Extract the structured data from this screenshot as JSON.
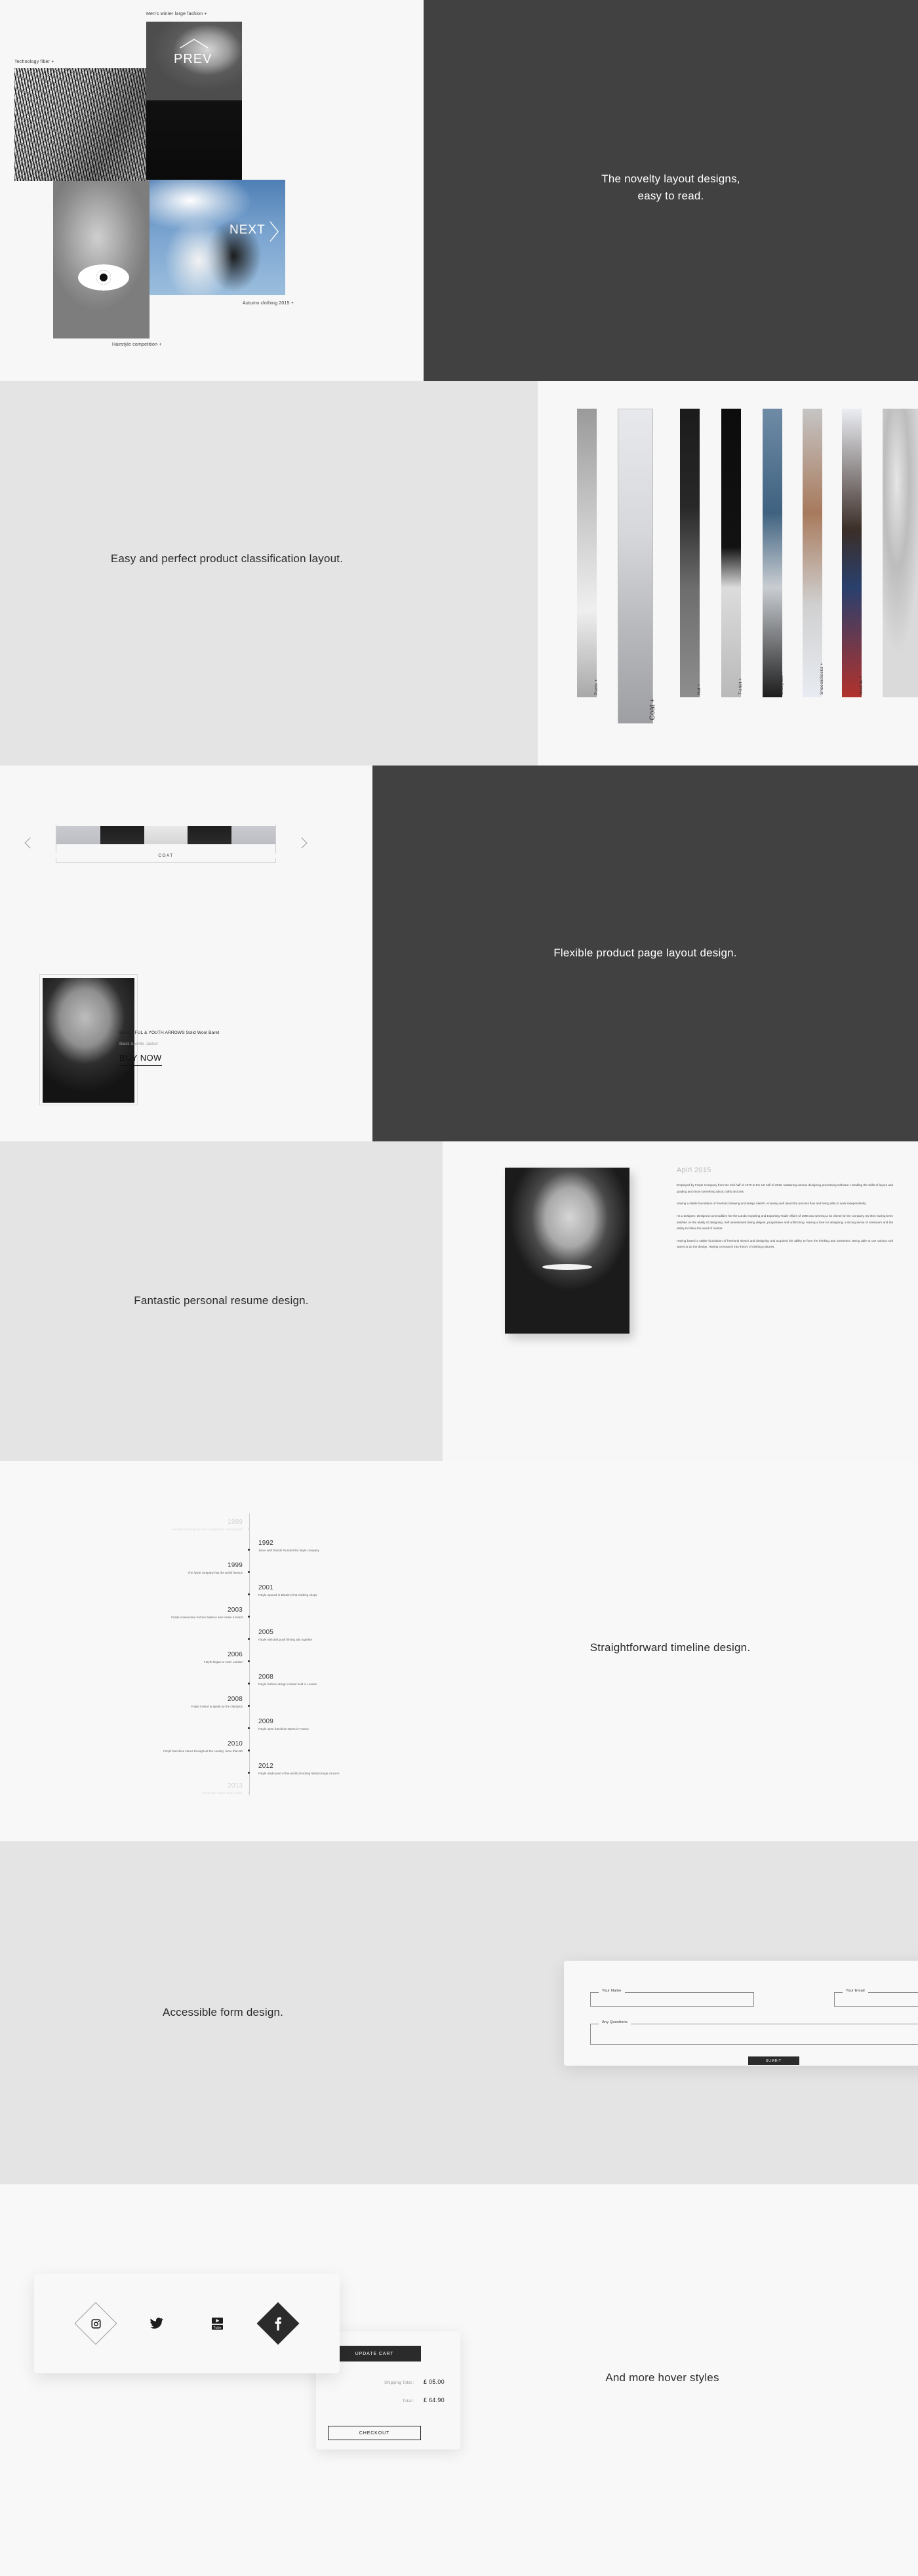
{
  "sections": {
    "hero": {
      "tagline_line1": "The novelty layout designs,",
      "tagline_line2": "easy to read.",
      "captions": {
        "fiber": "Technology fiber +",
        "winter": "Men's winter large fashion +",
        "hairstyle": "Hairstyle competition +",
        "autumn": "Autumn clothing 2015 +"
      },
      "nav": {
        "prev": "PREV",
        "next": "NEXT"
      }
    },
    "classification": {
      "tagline": "Easy and perfect product classification layout.",
      "categories": [
        {
          "label": "Pants +",
          "featured": false
        },
        {
          "label": "Coat +",
          "featured": true
        },
        {
          "label": "Hat +",
          "featured": false
        },
        {
          "label": "T-shirt +",
          "featured": false
        },
        {
          "label": "Backpack +",
          "featured": false
        },
        {
          "label": "Shoes&Socks +",
          "featured": false
        },
        {
          "label": "Necktie +",
          "featured": false
        }
      ]
    },
    "product": {
      "tagline": "Flexible product page layout design.",
      "slider_label": "COAT",
      "title": "BEAYTIFUL & YOUTH ARROWS Solid Wool Baret",
      "subtitle": "Black & white Jacket",
      "buy_label": "BUY NOW"
    },
    "resume": {
      "tagline": "Fantastic personal resume design.",
      "date": "Apirl 2015",
      "paragraphs": [
        "Employed by Futyle Company from the 2nd half of 1976 to the 1st half of 2016. Mastering various designing processing software. Handling the skills of layout and grading and know something about crafts and arts.",
        "Having a stable foundation of freehand drawing and design sketch. Knowing well about the process flow and being able to work independently.",
        "As a designer. Designed commodities foe the Londo Importing and Exporting Trade Affairs of 1998 and winning a lot clients for the company. By then having been testified on the ability of designing. Self assessment Being diligent, progressive and unflinching. Having a love for designing, a strong sense of teamwork and the ability to follow the need of market.",
        "Having based a stable foundation of freehand sketch and designing and acquired the ability to form the thinking and aesthetics. Being able to use various soft wares to do the design. Having a research into theory of clothing cultures."
      ]
    },
    "timeline": {
      "tagline": "Straightforward timeline design.",
      "events": [
        {
          "year": "1989",
          "text": "Jasonthe first original work is eligible for Global Award",
          "side": "left",
          "faded": true
        },
        {
          "year": "1992",
          "text": "Jason with friends founded the futyle company",
          "side": "right",
          "faded": false
        },
        {
          "year": "1999",
          "text": "The futyle company has the world famous",
          "side": "left",
          "faded": false
        },
        {
          "year": "2001",
          "text": "Futyle opened in Britain's first clothing shops",
          "side": "right",
          "faded": false
        },
        {
          "year": "2003",
          "text": "Futyle consecutive hot ten balance and create a brand",
          "side": "left",
          "faded": false
        },
        {
          "year": "2005",
          "text": "Futyle with daft punk filming ads together",
          "side": "right",
          "faded": false
        },
        {
          "year": "2006",
          "text": "Futyle began to enter London",
          "side": "left",
          "faded": false
        },
        {
          "year": "2008",
          "text": "Futyle fashion design contest held in London",
          "side": "right",
          "faded": false
        },
        {
          "year": "2008",
          "text": "Futyle invited to speak by the Olympics",
          "side": "left",
          "faded": false
        },
        {
          "year": "2009",
          "text": "Futyle open franchise stores in France",
          "side": "right",
          "faded": false
        },
        {
          "year": "2010",
          "text": "Futyle franchise stores throughout the country, more than 60",
          "side": "left",
          "faded": false
        },
        {
          "year": "2012",
          "text": "Futyle made [end of the world] shooting fashion large concern",
          "side": "right",
          "faded": false
        },
        {
          "year": "2013",
          "text": "Futyle total assets of ten billion",
          "side": "left",
          "faded": true
        }
      ]
    },
    "form": {
      "tagline": "Accessible form design.",
      "fields": [
        {
          "legend": "Your Name",
          "value": ""
        },
        {
          "legend": "Your Email",
          "value": ""
        },
        {
          "legend": "Any Questions",
          "value": ""
        }
      ],
      "submit_label": "SUMBIT"
    },
    "hover": {
      "tagline": "And more hover styles",
      "social": [
        {
          "name": "instagram-icon",
          "style": "outline"
        },
        {
          "name": "twitter-icon",
          "style": "plain"
        },
        {
          "name": "youtube-icon",
          "style": "plain"
        },
        {
          "name": "facebook-icon",
          "style": "filled"
        }
      ],
      "cart": {
        "update_label": "UPDATE CART",
        "shipping_label": "Shipping Total :",
        "shipping_value": "£ 05.00",
        "total_label": "Total :",
        "total_value": "£ 64.90",
        "checkout_label": "CHECKOUT"
      }
    }
  },
  "colors": {
    "dark_panel": "#414141",
    "light_bg": "#f7f7f7",
    "grey_bg": "#e4e4e4",
    "accent_dark": "#2b2b2b"
  }
}
